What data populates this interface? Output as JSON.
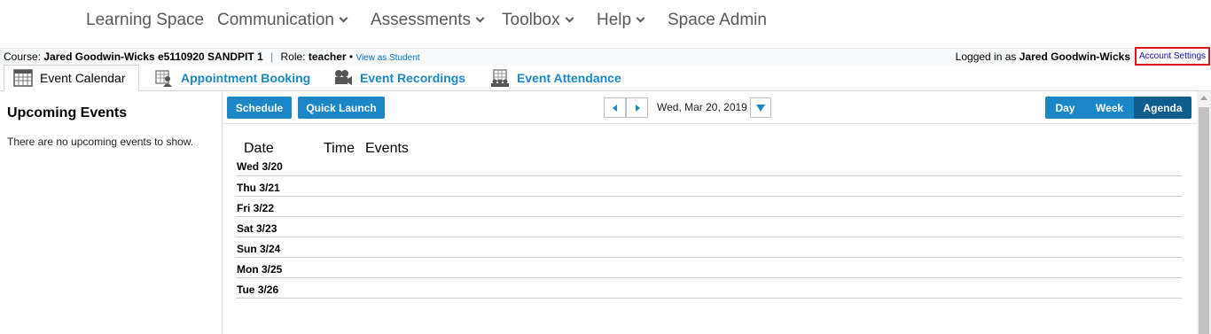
{
  "topnav": {
    "items": [
      {
        "label": "Learning Space",
        "has_dropdown": false
      },
      {
        "label": "Communication",
        "has_dropdown": true
      },
      {
        "label": "Assessments",
        "has_dropdown": true
      },
      {
        "label": "Toolbox",
        "has_dropdown": true
      },
      {
        "label": "Help",
        "has_dropdown": true
      },
      {
        "label": "Space Admin",
        "has_dropdown": false
      }
    ]
  },
  "coursebar": {
    "course_prefix": "Course:",
    "course_name": "Jared Goodwin-Wicks e5110920 SANDPIT 1",
    "role_prefix": "Role:",
    "role": "teacher",
    "view_as": "View as Student",
    "logged_prefix": "Logged in as",
    "user": "Jared Goodwin-Wicks",
    "account_settings": "Account Settings"
  },
  "tabs": [
    {
      "label": "Event Calendar",
      "icon": "calendar-icon",
      "active": true
    },
    {
      "label": "Appointment Booking",
      "icon": "appointment-icon",
      "active": false
    },
    {
      "label": "Event Recordings",
      "icon": "camera-icon",
      "active": false
    },
    {
      "label": "Event Attendance",
      "icon": "attendance-icon",
      "active": false
    }
  ],
  "sidebar": {
    "title": "Upcoming Events",
    "empty_text": "There are no upcoming events to show."
  },
  "toolbar": {
    "schedule": "Schedule",
    "quick_launch": "Quick Launch",
    "date": "Wed, Mar 20, 2019",
    "views": [
      "Day",
      "Week",
      "Agenda"
    ],
    "active_view": "Agenda"
  },
  "agenda": {
    "headers": {
      "date": "Date",
      "time": "Time",
      "events": "Events"
    },
    "rows": [
      "Wed 3/20",
      "Thu 3/21",
      "Fri 3/22",
      "Sat 3/23",
      "Sun 3/24",
      "Mon 3/25",
      "Tue 3/26"
    ]
  },
  "colors": {
    "accent": "#1b87c7",
    "accent_dark": "#0f5d8c",
    "highlight_border": "#e0121a"
  }
}
